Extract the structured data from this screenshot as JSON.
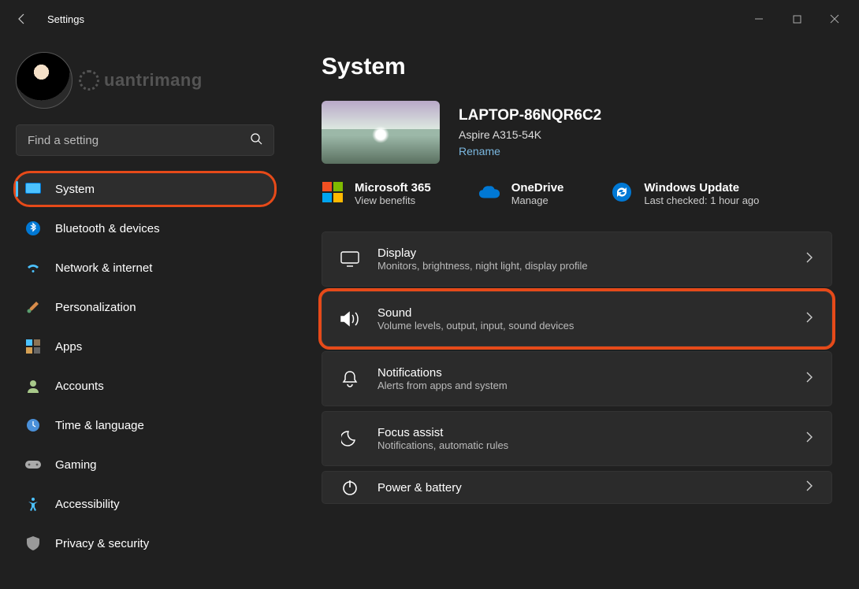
{
  "titlebar": {
    "title": "Settings"
  },
  "search": {
    "placeholder": "Find a setting"
  },
  "watermark": "uantrimang",
  "nav": [
    {
      "label": "System"
    },
    {
      "label": "Bluetooth & devices"
    },
    {
      "label": "Network & internet"
    },
    {
      "label": "Personalization"
    },
    {
      "label": "Apps"
    },
    {
      "label": "Accounts"
    },
    {
      "label": "Time & language"
    },
    {
      "label": "Gaming"
    },
    {
      "label": "Accessibility"
    },
    {
      "label": "Privacy & security"
    }
  ],
  "page": {
    "title": "System"
  },
  "device": {
    "name": "LAPTOP-86NQR6C2",
    "model": "Aspire A315-54K",
    "rename": "Rename"
  },
  "cloud": {
    "m365": {
      "title": "Microsoft 365",
      "sub": "View benefits"
    },
    "onedrive": {
      "title": "OneDrive",
      "sub": "Manage"
    },
    "update": {
      "title": "Windows Update",
      "sub": "Last checked: 1 hour ago"
    }
  },
  "settings": [
    {
      "title": "Display",
      "sub": "Monitors, brightness, night light, display profile"
    },
    {
      "title": "Sound",
      "sub": "Volume levels, output, input, sound devices"
    },
    {
      "title": "Notifications",
      "sub": "Alerts from apps and system"
    },
    {
      "title": "Focus assist",
      "sub": "Notifications, automatic rules"
    },
    {
      "title": "Power & battery",
      "sub": ""
    }
  ]
}
